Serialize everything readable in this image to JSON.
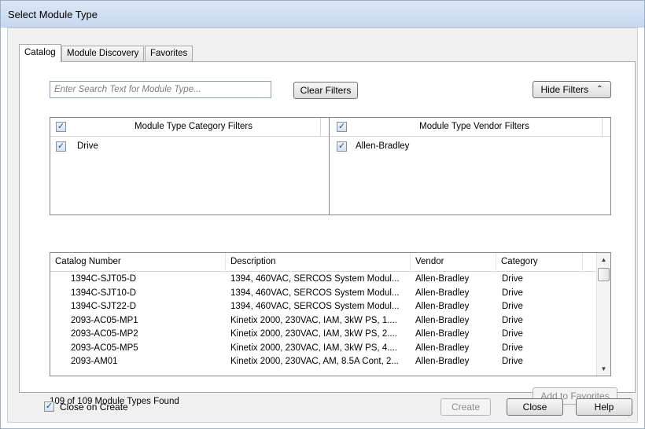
{
  "window": {
    "title": "Select Module Type"
  },
  "tabs": [
    {
      "label": "Catalog",
      "active": true
    },
    {
      "label": "Module Discovery",
      "active": false
    },
    {
      "label": "Favorites",
      "active": false
    }
  ],
  "search": {
    "placeholder": "Enter Search Text for Module Type..."
  },
  "buttons": {
    "clear_filters": "Clear Filters",
    "hide_filters": "Hide Filters",
    "add_to_favorites": "Add to Favorites",
    "create": "Create",
    "close": "Close",
    "help": "Help"
  },
  "icons": {
    "hide_filters": "double-chevron-up-icon",
    "scroll_up": "up-arrow-icon",
    "scroll_down": "down-arrow-icon"
  },
  "category_filters": {
    "header": "Module Type Category Filters",
    "header_checked": true,
    "items": [
      {
        "label": "Drive",
        "checked": true
      }
    ]
  },
  "vendor_filters": {
    "header": "Module Type Vendor Filters",
    "header_checked": true,
    "items": [
      {
        "label": "Allen-Bradley",
        "checked": true
      }
    ]
  },
  "table": {
    "columns": [
      "Catalog Number",
      "Description",
      "Vendor",
      "Category"
    ],
    "rows": [
      [
        "1394C-SJT05-D",
        "1394, 460VAC, SERCOS System Modul...",
        "Allen-Bradley",
        "Drive"
      ],
      [
        "1394C-SJT10-D",
        "1394, 460VAC, SERCOS System Modul...",
        "Allen-Bradley",
        "Drive"
      ],
      [
        "1394C-SJT22-D",
        "1394, 460VAC, SERCOS System Modul...",
        "Allen-Bradley",
        "Drive"
      ],
      [
        "2093-AC05-MP1",
        "Kinetix 2000, 230VAC, IAM, 3kW PS, 1....",
        "Allen-Bradley",
        "Drive"
      ],
      [
        "2093-AC05-MP2",
        "Kinetix 2000, 230VAC, IAM, 3kW PS, 2....",
        "Allen-Bradley",
        "Drive"
      ],
      [
        "2093-AC05-MP5",
        "Kinetix 2000, 230VAC, IAM, 3kW PS, 4....",
        "Allen-Bradley",
        "Drive"
      ],
      [
        "2093-AM01",
        "Kinetix 2000, 230VAC, AM, 8.5A Cont, 2...",
        "Allen-Bradley",
        "Drive"
      ]
    ]
  },
  "status": {
    "found_text": "109 of 109 Module Types Found"
  },
  "footer": {
    "close_on_create_label": "Close on Create",
    "close_on_create_checked": true
  }
}
